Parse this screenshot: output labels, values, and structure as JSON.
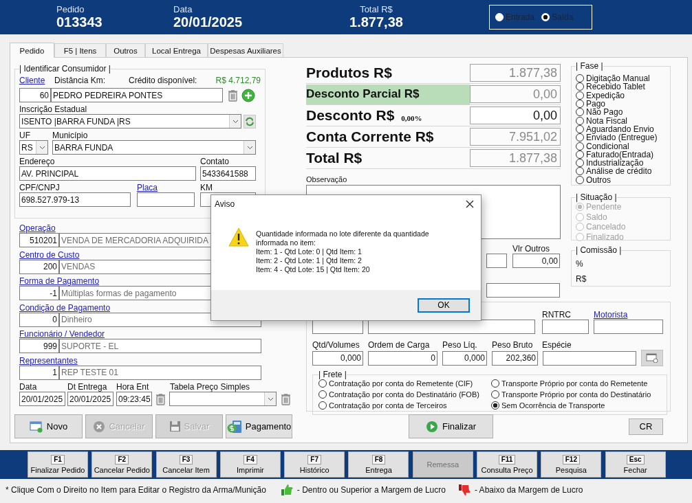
{
  "header": {
    "fields": [
      {
        "label": "Pedido",
        "value": "013343"
      },
      {
        "label": "Data",
        "value": "20/01/2025"
      },
      {
        "label": "Total R$",
        "value": "1.877,38"
      }
    ],
    "movement": [
      {
        "label": "Entrada",
        "selected": false
      },
      {
        "label": "Saída",
        "selected": true
      }
    ]
  },
  "tabs": [
    {
      "label": "Pedido",
      "selected": true
    },
    {
      "label": "F5 | Itens",
      "selected": false
    },
    {
      "label": "Outros",
      "selected": false
    },
    {
      "label": "Local Entrega",
      "selected": false
    },
    {
      "label": "Despesas Auxiliares",
      "selected": false
    }
  ],
  "consumer": {
    "title": "| Identificar Consumidor |",
    "cliente_link": "Cliente",
    "distance_label": "Distância Km:",
    "credit_label": "Crédito disponível:",
    "credit_value": "R$ 4.712,79",
    "client_code": "60",
    "client_name": "PEDRO PEDREIRA PONTES",
    "ie_label": "Inscrição Estadual",
    "ie_value": "ISENTO  |BARRA FUNDA  |RS",
    "uf_label": "UF",
    "uf_value": "RS",
    "municipio_label": "Município",
    "municipio_value": "BARRA FUNDA",
    "endereco_label": "Endereço",
    "endereco_value": "AV. PRINCIPAL",
    "contato_label": "Contato",
    "contato_value": "5433641588",
    "cpf_label": "CPF/CNPJ",
    "cpf_value": "698.527.979-13",
    "placa_link": "Placa",
    "km_label": "KM"
  },
  "lookups": [
    {
      "label": "Operação",
      "code": "510201",
      "description": "VENDA DE MERCADORIA ADQUIRIDA"
    },
    {
      "label": "Centro de Custo",
      "code": "200",
      "description": "VENDAS"
    },
    {
      "label": "Forma de Pagamento",
      "code": "-1",
      "description": "Múltiplas formas de pagamento"
    },
    {
      "label": "Condição de Pagamento",
      "code": "0",
      "description": "Dinheiro"
    },
    {
      "label": "Funcionário / Vendedor",
      "code": "999",
      "description": "SUPORTE - EL"
    },
    {
      "label": "Representantes",
      "code": "1",
      "description": "REP TESTE 01"
    }
  ],
  "dates": [
    {
      "label": "Data",
      "value": "20/01/2025"
    },
    {
      "label": "Dt Entrega",
      "value": "20/01/2025"
    },
    {
      "label": "Hora Ent",
      "value": "09:23:45"
    }
  ],
  "price_table_label": "Tabela Preço Simples",
  "actions": [
    {
      "kind": "new",
      "label": "Novo",
      "disabled": false
    },
    {
      "kind": "cancel",
      "label": "Cancelar",
      "disabled": true
    },
    {
      "kind": "save",
      "label": "Salvar",
      "disabled": true
    },
    {
      "kind": "payment",
      "label": "Pagamento",
      "disabled": false
    }
  ],
  "totals": [
    {
      "label": "Produtos R$",
      "value": "1.877,38",
      "highlighted": false,
      "readonly": true
    },
    {
      "label": "Desconto Parcial R$",
      "value": "0,00",
      "highlighted": true,
      "readonly": true
    },
    {
      "label": "Desconto R$",
      "percent": "0,00%",
      "value": "0,00",
      "highlighted": false,
      "readonly": false
    },
    {
      "label": "Conta Corrente R$",
      "value": "7.951,02",
      "highlighted": false,
      "readonly": true
    },
    {
      "label": "Total R$",
      "value": "1.877,38",
      "highlighted": false,
      "readonly": true
    }
  ],
  "observation_label": "Observação",
  "other_values": {
    "label": "Vlr Outros",
    "value": "0,00"
  },
  "fase": {
    "title": "| Fase |",
    "options": [
      {
        "label": "Digitação Manual",
        "selected": false
      },
      {
        "label": "Recebido Tablet",
        "selected": false
      },
      {
        "label": "Expedição",
        "selected": false
      },
      {
        "label": "Pago",
        "selected": false
      },
      {
        "label": "Não Pago",
        "selected": false
      },
      {
        "label": "Nota Fiscal",
        "selected": false
      },
      {
        "label": "Aguardando Envio",
        "selected": false
      },
      {
        "label": "Enviado (Entregue)",
        "selected": false
      },
      {
        "label": "Condicional",
        "selected": false
      },
      {
        "label": "Faturado(Entrada)",
        "selected": false
      },
      {
        "label": "Industrialização",
        "selected": false
      },
      {
        "label": "Análise de crédito",
        "selected": false
      },
      {
        "label": "Outros",
        "selected": false
      }
    ]
  },
  "situacao": {
    "title": "| Situação |",
    "options": [
      {
        "label": "Pendente",
        "selected": true,
        "disabled": true
      },
      {
        "label": "Saldo",
        "selected": false,
        "disabled": true
      },
      {
        "label": "Cancelado",
        "selected": false,
        "disabled": true
      },
      {
        "label": "Finalizado",
        "selected": false,
        "disabled": true
      }
    ]
  },
  "comissao": {
    "title": "| Comissão |",
    "percent_label": "%",
    "value_label": "R$"
  },
  "transport": {
    "rntrc_label": "RNTRC",
    "motorista_link": "Motorista",
    "fields": [
      {
        "label": "Qtd/Volumes",
        "value": "0,000"
      },
      {
        "label": "Ordem de Carga",
        "value": "0"
      },
      {
        "label": "Peso Líq.",
        "value": "0,000"
      },
      {
        "label": "Peso Bruto",
        "value": "202,360"
      },
      {
        "label": "Espécie"
      }
    ],
    "frete": {
      "title": "| Frete |",
      "options": [
        {
          "label": "Contratação por conta do Remetente (CIF)",
          "selected": false
        },
        {
          "label": "Transporte Próprio por conta do Remetente",
          "selected": false
        },
        {
          "label": "Contratação por conta do Destinatário (FOB)",
          "selected": false
        },
        {
          "label": "Transporte Próprio por conta do Destinatário",
          "selected": false
        },
        {
          "label": "Contratação por conta de Terceiros",
          "selected": false
        },
        {
          "label": "Sem Ocorrência de Transporte",
          "selected": true
        }
      ]
    }
  },
  "finalize_button": "Finalizar",
  "cr_button": "CR",
  "function_keys": [
    {
      "key": "F1",
      "label": "Finalizar Pedido",
      "disabled": false
    },
    {
      "key": "F2",
      "label": "Cancelar Pedido",
      "disabled": false
    },
    {
      "key": "F3",
      "label": "Cancelar Item",
      "disabled": false
    },
    {
      "key": "F4",
      "label": "Imprimir",
      "disabled": false
    },
    {
      "key": "F7",
      "label": "Histórico",
      "disabled": false
    },
    {
      "key": "F8",
      "label": "Entrega",
      "disabled": false
    },
    {
      "label": "Remessa",
      "disabled": true
    },
    {
      "key": "F11",
      "label": "Consulta Preço",
      "disabled": false
    },
    {
      "key": "F12",
      "label": "Pesquisa",
      "disabled": false
    },
    {
      "key": "Esc",
      "label": "Fechar",
      "disabled": false
    }
  ],
  "status_bar": {
    "hint": "* Clique Com o Direito no Item para Editar o Registro da Arma/Munição",
    "legend": [
      {
        "kind": "thumbs_up",
        "text": "- Dentro ou Superior a Margem de Lucro"
      },
      {
        "kind": "thumbs_down",
        "text": "- Abaixo da Margem de Lucro"
      }
    ]
  },
  "dialog": {
    "title": "Aviso",
    "message": "Quantidade informada no lote diferente da quantidade\ninformada no item:\nItem: 1 - Qtd Lote: 0 | Qtd Item: 1\nItem: 2 - Qtd Lote: 1 | Qtd Item: 2\nItem: 4 - Qtd Lote: 15 | Qtd Item: 20",
    "button": "OK"
  }
}
